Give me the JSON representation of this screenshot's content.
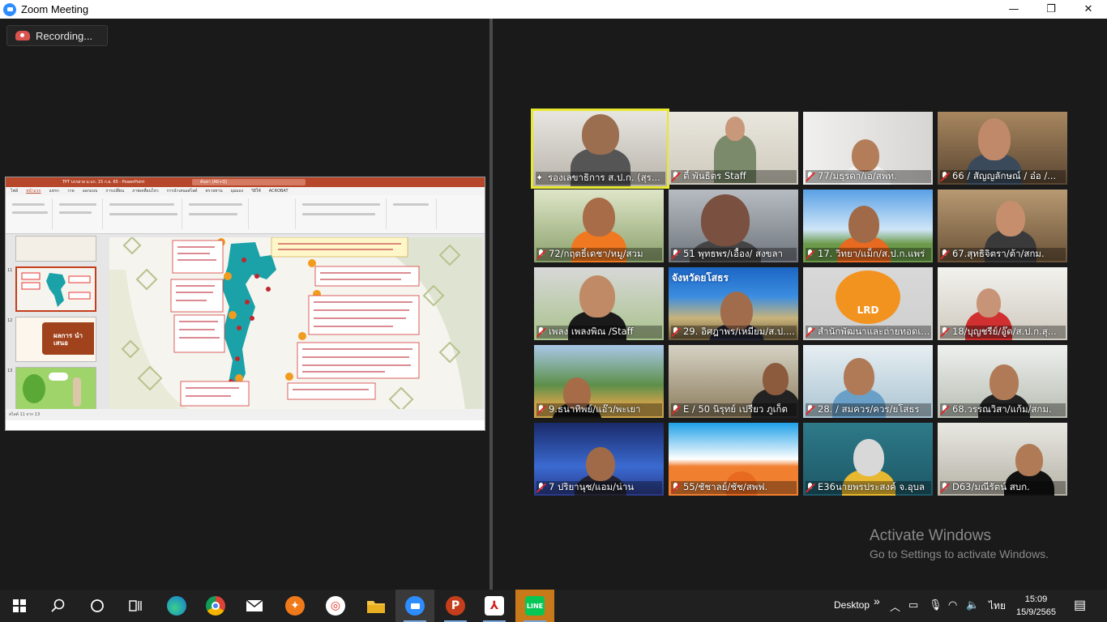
{
  "window": {
    "title": "Zoom Meeting",
    "minimize": "—",
    "maximize": "❐",
    "close": "✕"
  },
  "recording": {
    "label": "Recording..."
  },
  "shared_screen": {
    "ppt_title": "TPT บรรยาย ม.บก. 15 ก.ย. 65  -  PowerPoint",
    "search_placeholder": "ค้นหา (Alt+Q)",
    "tabs": [
      "ไฟล์",
      "หน้าแรก",
      "แทรก",
      "วาด",
      "ออกแบบ",
      "การเปลี่ยน",
      "ภาพเคลื่อนไหว",
      "การนำเสนอสไลด์",
      "ตรวจทาน",
      "มุมมอง",
      "วิธีใช้",
      "ACROBAT"
    ],
    "thumb_numbers": [
      "11",
      "12",
      "13"
    ],
    "thumb12_text": "ผลการ นำเสนอ",
    "status": "สไลด์ 11 จาก 13",
    "slide_footer": "©PolicyBriefDesign@gmail.com   Facebook : PowerPoint Hub   Not allow on commercial use."
  },
  "participants": [
    {
      "name": "รองเลขาธิการ ส.ป.ก. (สุร...",
      "muted": false,
      "pinned": true,
      "active": true
    },
    {
      "name": "ตี้ พันธิตร Staff",
      "muted": true,
      "pinned": false,
      "active": false
    },
    {
      "name": "77/มธุรดา/เอ/สพท.",
      "muted": true,
      "pinned": false,
      "active": false
    },
    {
      "name": "66 / สัญญลักษณ์ / อ๋อ /...",
      "muted": true,
      "pinned": false,
      "active": false
    },
    {
      "name": "72/กฤตธิ์เดชา/หมู/สวม",
      "muted": true,
      "pinned": false,
      "active": false
    },
    {
      "name": "51 พุทธพร/เอื้อง/ สงขลา",
      "muted": true,
      "pinned": false,
      "active": false
    },
    {
      "name": "17. วิทยา/แม็ก/ส.ป.ก.แพร่",
      "muted": true,
      "pinned": false,
      "active": false
    },
    {
      "name": "67.สุทธิจิตรา/ต้า/สกม.",
      "muted": true,
      "pinned": false,
      "active": false
    },
    {
      "name": "เพลง เพลงพิณ /Staff",
      "muted": true,
      "pinned": false,
      "active": false
    },
    {
      "name": "29. อิศฎาพร/เหมียม/ส.ป....",
      "muted": true,
      "pinned": false,
      "active": false
    },
    {
      "name": "สำนักพัฒนาและถ่ายทอดเ...",
      "muted": true,
      "pinned": false,
      "active": false
    },
    {
      "name": "18/บุญชรีย์/อู๊ด/ส.ป.ก.สุ...",
      "muted": true,
      "pinned": false,
      "active": false
    },
    {
      "name": "9.ธนาทิพย์/แอ๊ว/พะเยา",
      "muted": true,
      "pinned": false,
      "active": false
    },
    {
      "name": "E / 50 นิรุทย์ เปรียว ภูเก็ต",
      "muted": true,
      "pinned": false,
      "active": false
    },
    {
      "name": "28. / สมควร/ควร/ยโสธร",
      "muted": true,
      "pinned": false,
      "active": false
    },
    {
      "name": "68.วรรณวิสา/แก้ม/สกม.",
      "muted": true,
      "pinned": false,
      "active": false
    },
    {
      "name": "7 ปริยานุช/แอม/น่าน",
      "muted": true,
      "pinned": false,
      "active": false
    },
    {
      "name": "55/ชัชาลย์/ชัช/สพฟ.",
      "muted": true,
      "pinned": false,
      "active": false
    },
    {
      "name": "E36นายพรประสงค์  จ.อุบล",
      "muted": true,
      "pinned": false,
      "active": false
    },
    {
      "name": "D63/มณีรัตน์ สบก.",
      "muted": true,
      "pinned": false,
      "active": false
    }
  ],
  "tile_banners": {
    "t10": "จังหวัดยโสธร",
    "t11_logo": "LRD"
  },
  "activate": {
    "line1": "Activate Windows",
    "line2": "Go to Settings to activate Windows."
  },
  "taskbar": {
    "desktop_label": "Desktop",
    "chevron": "»",
    "lang": "ไทย",
    "time": "15:09",
    "date": "15/9/2565"
  },
  "colors": {
    "active_speaker": "#e8e830",
    "mute_red": "#e02828",
    "ppt_accent": "#b7472a",
    "zoom_blue": "#2d8cff"
  }
}
